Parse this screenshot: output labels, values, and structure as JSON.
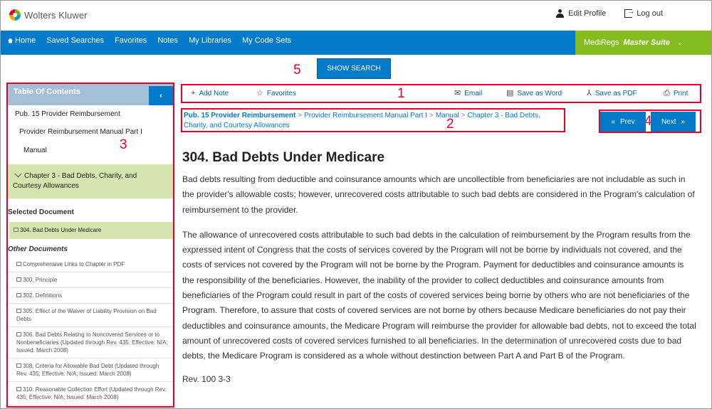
{
  "brand": {
    "name": "Wolters Kluwer"
  },
  "user_links": {
    "edit_profile": "Edit Profile",
    "logout": "Log out"
  },
  "nav": {
    "items": [
      "Home",
      "Saved Searches",
      "Favorites",
      "Notes",
      "My Libraries",
      "My Code Sets"
    ],
    "suite": "MediRegs",
    "suite_sub": "Master Suite",
    "suite_chevron": "⌄"
  },
  "show_search": "SHOW SEARCH",
  "annotations": [
    "1",
    "2",
    "3",
    "4",
    "5"
  ],
  "toc": {
    "title": "Table Of Contents",
    "collapse_glyph": "‹",
    "items": [
      "Pub. 15 Provider Reimbursement",
      "Provider Reimbursement Manual Part I",
      "Manual"
    ],
    "active_chapter": "Chapter 3 - Bad Debts, Charity, and Courtesy Allowances",
    "selected_title": "Selected Document",
    "selected_doc": "304. Bad Debts Under Medicare",
    "other_title": "Other Documents",
    "other_docs": [
      "Comprehensive Links to Chapter in PDF",
      "300. Principle",
      "302. Definitions",
      "305. Effect of the Waiver of Liability Provision on Bad Debts",
      "306. Bad Debts Relating to Noncovered Services or to Nonbeneficiaries (Updated through Rev. 435; Effective: N/A; Issued: March 2008)",
      "308. Criteria for Allowable Bad Debt (Updated through Rev. 435; Effective: N/A; Issued: March 2008)",
      "310. Reasonable Collection Effort (Updated through Rev. 435; Effective: N/A; Issued: March 2008)"
    ]
  },
  "toolbar": {
    "add_note": "Add Note",
    "favorites": "Favorites",
    "email": "Email",
    "save_word": "Save as Word",
    "save_pdf": "Save as PDF",
    "print": "Print"
  },
  "breadcrumb": {
    "items": [
      "Pub. 15 Provider Reimbursement",
      "Provider Reimbursement Manual Part I",
      "Manual",
      "Chapter 3 - Bad Debts, Charity, and Courtesy Allowances"
    ],
    "separator": ">"
  },
  "pager": {
    "prev": "Prev",
    "next": "Next"
  },
  "document": {
    "title": "304. Bad Debts Under Medicare",
    "paragraphs": [
      "Bad debts resulting from deductible and coinsurance amounts which are uncollectible from beneficiaries are not includable as such in the provider's allowable costs; however, unrecovered costs attributable to such bad debts are considered in the Program's calculation of reimbursement to the provider.",
      "The allowance of unrecovered costs attributable to such bad debts in the calculation of reimbursement by the Program results from the expressed intent of Congress that the costs of services covered by the Program will not be borne by individuals not covered, and the costs of services not covered by the Program will not be borne by the Program. Payment for deductibles and coinsurance amounts is the responsibility of the beneficiaries. However, the inability of the provider to collect deductibles and coinsurance amounts from beneficiaries of the Program could result in part of the costs of covered services being borne by others who are not beneficiaries of the Program. Therefore, to assure that costs of covered services are not borne by others because Medicare beneficiaries do not pay their deductibles and coinsurance amounts, the Medicare Program will reimburse the provider for allowable bad debts, not to exceed the total amount of unrecovered costs of covered services furnished to all beneficiaries. In the determination of unrecovered costs due to bad debts, the Medicare Program is considered as a whole without destinction between Part A and Part B of the Program."
    ],
    "revision": "Rev. 100 3-3"
  }
}
